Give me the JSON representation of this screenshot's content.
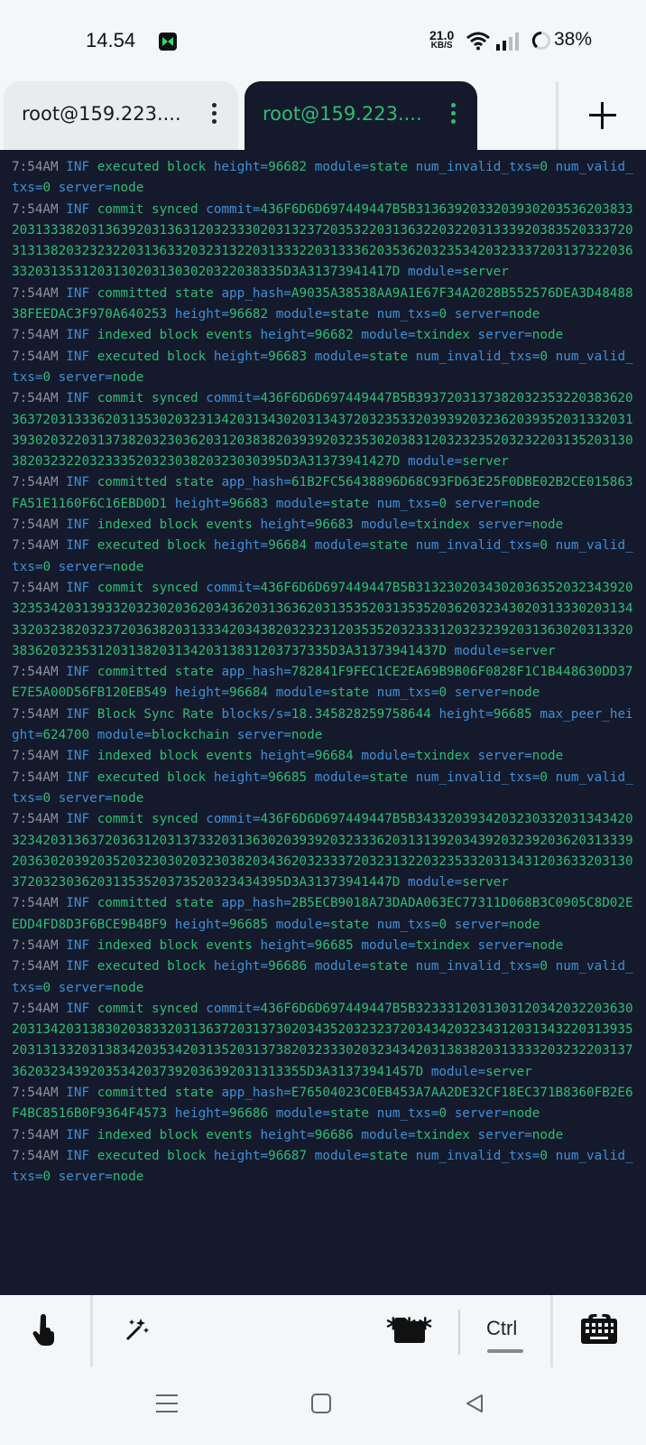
{
  "status_bar": {
    "time": "14.54",
    "net_speed_value": "21.0",
    "net_speed_unit": "KB/S",
    "battery": "38%"
  },
  "tabs": [
    {
      "label": "root@159.223....",
      "active": false
    },
    {
      "label": "root@159.223....",
      "active": true
    }
  ],
  "terminal": {
    "lines": [
      {
        "ts": "7:54AM",
        "lvl": "INF",
        "msg": "executed block",
        "kv": [
          [
            "height",
            "96682"
          ],
          [
            "module",
            "state"
          ],
          [
            "num_invalid_txs",
            "0"
          ],
          [
            "num_valid_txs",
            "0"
          ],
          [
            "server",
            "node"
          ]
        ]
      },
      {
        "ts": "7:54AM",
        "lvl": "INF",
        "msg": "commit synced",
        "kv": [
          [
            "commit",
            "436F6D6D697449447B5B3136392033203930203536203833203133382031363920313631203233302031323720353220313632203220313339203835203337203131382032323220313633203231322031333220313336203536203235342032333720313732203633203135312031302031303020322038335D3A31373941417D"
          ],
          [
            "module",
            "server"
          ]
        ]
      },
      {
        "ts": "7:54AM",
        "lvl": "INF",
        "msg": "committed state",
        "kv": [
          [
            "app_hash",
            "A9035A38538AA9A1E67F34A2028B552576DEA3D4848838FEEDAC3F970A640253"
          ],
          [
            "height",
            "96682"
          ],
          [
            "module",
            "state"
          ],
          [
            "num_txs",
            "0"
          ],
          [
            "server",
            "node"
          ]
        ]
      },
      {
        "ts": "7:54AM",
        "lvl": "INF",
        "msg": "indexed block events",
        "kv": [
          [
            "height",
            "96682"
          ],
          [
            "module",
            "txindex"
          ],
          [
            "server",
            "node"
          ]
        ]
      },
      {
        "ts": "7:54AM",
        "lvl": "INF",
        "msg": "executed block",
        "kv": [
          [
            "height",
            "96683"
          ],
          [
            "module",
            "state"
          ],
          [
            "num_invalid_txs",
            "0"
          ],
          [
            "num_valid_txs",
            "0"
          ],
          [
            "server",
            "node"
          ]
        ]
      },
      {
        "ts": "7:54AM",
        "lvl": "INF",
        "msg": "commit synced",
        "kv": [
          [
            "commit",
            "436F6D6D697449447B5B3937203137382032353220383620363720313336203135302032313420313430203134372032353320393920323620393520313320313930203220313738203230362031203838203939203235302038312032323520323220313520313038203232203233352032303820323030395D3A31373941427D"
          ],
          [
            "module",
            "server"
          ]
        ]
      },
      {
        "ts": "7:54AM",
        "lvl": "INF",
        "msg": "committed state",
        "kv": [
          [
            "app_hash",
            "61B2FC56438896D68C93FD63E25F0DBE02B2CE015863FA51E1160F6C16EBD0D1"
          ],
          [
            "height",
            "96683"
          ],
          [
            "module",
            "state"
          ],
          [
            "num_txs",
            "0"
          ],
          [
            "server",
            "node"
          ]
        ]
      },
      {
        "ts": "7:54AM",
        "lvl": "INF",
        "msg": "indexed block events",
        "kv": [
          [
            "height",
            "96683"
          ],
          [
            "module",
            "txindex"
          ],
          [
            "server",
            "node"
          ]
        ]
      },
      {
        "ts": "7:54AM",
        "lvl": "INF",
        "msg": "executed block",
        "kv": [
          [
            "height",
            "96684"
          ],
          [
            "module",
            "state"
          ],
          [
            "num_invalid_txs",
            "0"
          ],
          [
            "num_valid_txs",
            "0"
          ],
          [
            "server",
            "node"
          ]
        ]
      },
      {
        "ts": "7:54AM",
        "lvl": "INF",
        "msg": "commit synced",
        "kv": [
          [
            "commit",
            "436F6D6D697449447B5B3132302034302036352032343920323534203139332032302036203436203136362031353520313535203620323430203133302031343320323820323720363820313334203438203232312035352032333120323239203136302031332038362032353120313820313420313831203737335D3A31373941437D"
          ],
          [
            "module",
            "server"
          ]
        ]
      },
      {
        "ts": "7:54AM",
        "lvl": "INF",
        "msg": "committed state",
        "kv": [
          [
            "app_hash",
            "782841F9FEC1CE2EA69B9B06F0828F1C1B448630DD37E7E5A00D56FB120EB549"
          ],
          [
            "height",
            "96684"
          ],
          [
            "module",
            "state"
          ],
          [
            "num_txs",
            "0"
          ],
          [
            "server",
            "node"
          ]
        ]
      },
      {
        "ts": "7:54AM",
        "lvl": "INF",
        "msg": "Block Sync Rate",
        "kv": [
          [
            "blocks/s",
            "18.345828259758644"
          ],
          [
            "height",
            "96685"
          ],
          [
            "max_peer_height",
            "624700"
          ],
          [
            "module",
            "blockchain"
          ],
          [
            "server",
            "node"
          ]
        ]
      },
      {
        "ts": "7:54AM",
        "lvl": "INF",
        "msg": "indexed block events",
        "kv": [
          [
            "height",
            "96684"
          ],
          [
            "module",
            "txindex"
          ],
          [
            "server",
            "node"
          ]
        ]
      },
      {
        "ts": "7:54AM",
        "lvl": "INF",
        "msg": "executed block",
        "kv": [
          [
            "height",
            "96685"
          ],
          [
            "module",
            "state"
          ],
          [
            "num_invalid_txs",
            "0"
          ],
          [
            "num_valid_txs",
            "0"
          ],
          [
            "server",
            "node"
          ]
        ]
      },
      {
        "ts": "7:54AM",
        "lvl": "INF",
        "msg": "commit synced",
        "kv": [
          [
            "commit",
            "436F6D6D697449447B5B3433203934203230332031343420323420313637203631203137332031363020393920323336203131392034392032392036203133392036302039203520323030203230382034362032333720323132203235332031343120363320313037203230362031353520373520323434395D3A31373941447D"
          ],
          [
            "module",
            "server"
          ]
        ]
      },
      {
        "ts": "7:54AM",
        "lvl": "INF",
        "msg": "committed state",
        "kv": [
          [
            "app_hash",
            "2B5ECB9018A73DADA063EC77311D068B3C0905C8D02EEDD4FD8D3F6BCE9B4BF9"
          ],
          [
            "height",
            "96685"
          ],
          [
            "module",
            "state"
          ],
          [
            "num_txs",
            "0"
          ],
          [
            "server",
            "node"
          ]
        ]
      },
      {
        "ts": "7:54AM",
        "lvl": "INF",
        "msg": "indexed block events",
        "kv": [
          [
            "height",
            "96685"
          ],
          [
            "module",
            "txindex"
          ],
          [
            "server",
            "node"
          ]
        ]
      },
      {
        "ts": "7:54AM",
        "lvl": "INF",
        "msg": "executed block",
        "kv": [
          [
            "height",
            "96686"
          ],
          [
            "module",
            "state"
          ],
          [
            "num_invalid_txs",
            "0"
          ],
          [
            "num_valid_txs",
            "0"
          ],
          [
            "server",
            "node"
          ]
        ]
      },
      {
        "ts": "7:54AM",
        "lvl": "INF",
        "msg": "commit synced",
        "kv": [
          [
            "commit",
            "436F6D6D697449447B5B3233312031303120342032203630203134203138302038332031363720313730203435203232372034342032343120313432203139352031313320313834203534203135203137382032333020323434203138382031333320323220313736203234392035342037392036392031313355D3A31373941457D"
          ],
          [
            "module",
            "server"
          ]
        ]
      },
      {
        "ts": "7:54AM",
        "lvl": "INF",
        "msg": "committed state",
        "kv": [
          [
            "app_hash",
            "E76504023C0EB453A7AA2DE32CF18EC371B8360FB2E6F4BC8516B0F9364F4573"
          ],
          [
            "height",
            "96686"
          ],
          [
            "module",
            "state"
          ],
          [
            "num_txs",
            "0"
          ],
          [
            "server",
            "node"
          ]
        ]
      },
      {
        "ts": "7:54AM",
        "lvl": "INF",
        "msg": "indexed block events",
        "kv": [
          [
            "height",
            "96686"
          ],
          [
            "module",
            "txindex"
          ],
          [
            "server",
            "node"
          ]
        ]
      },
      {
        "ts": "7:54AM",
        "lvl": "INF",
        "msg": "executed block",
        "kv": [
          [
            "height",
            "96687"
          ],
          [
            "module",
            "state"
          ],
          [
            "num_invalid_txs",
            "0"
          ],
          [
            "num_valid_txs",
            "0"
          ],
          [
            "server",
            "node"
          ]
        ]
      }
    ]
  },
  "keybar": {
    "stars_label": "***",
    "braces_label": "{}",
    "ctrl_label": "Ctrl"
  },
  "colors": {
    "terminal_bg": "#141a2c",
    "timestamp": "#8b929c",
    "key": "#3f8fd6",
    "value": "#2ebd74"
  },
  "icons": [
    "touch-icon",
    "magic-wand-icon",
    "folder-icon",
    "keyboard-icon",
    "menu-icon",
    "home-icon",
    "back-icon",
    "wifi-icon",
    "signal-icon",
    "battery-icon",
    "more-icon",
    "plus-icon"
  ]
}
